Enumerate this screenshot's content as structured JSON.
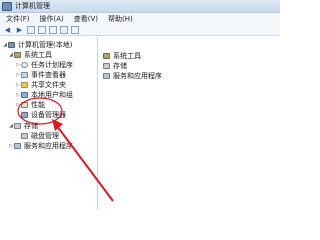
{
  "window": {
    "title": "计算机管理"
  },
  "menu": {
    "items": [
      "文件(F)",
      "操作(A)",
      "查看(V)",
      "帮助(H)"
    ]
  },
  "toolbar": {
    "buttons": [
      "back-icon",
      "forward-icon",
      "up-icon",
      "show-hide-tree-icon",
      "properties-icon",
      "help-icon",
      "view-icon"
    ]
  },
  "tree": {
    "root": "计算机管理(本地)",
    "system_tools": "系统工具",
    "task_scheduler": "任务计划程序",
    "event_viewer": "事件查看器",
    "shared_folders": "共享文件夹",
    "local_users": "本地用户和组",
    "performance": "性能",
    "device_manager": "设备管理器",
    "storage": "存储",
    "disk_management": "磁盘管理",
    "services": "服务和应用程序"
  },
  "right": {
    "items": [
      "系统工具",
      "存储",
      "服务和应用程序"
    ]
  },
  "annotation": {
    "color": "#e0191f"
  }
}
